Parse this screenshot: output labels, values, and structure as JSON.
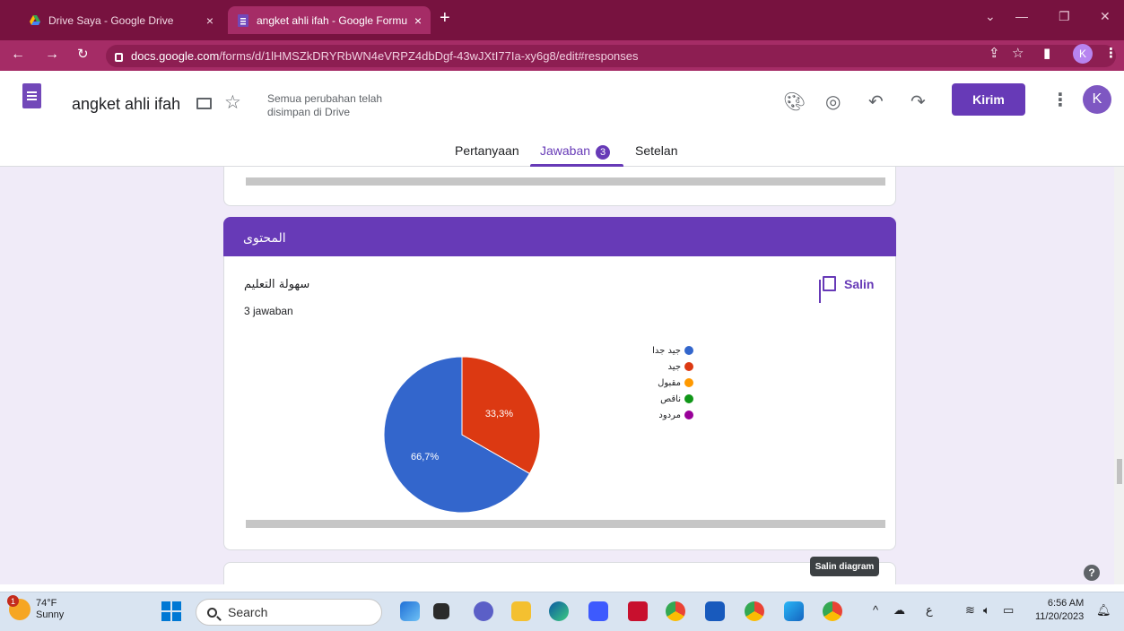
{
  "browser": {
    "tabs": [
      {
        "title": "Drive Saya - Google Drive",
        "icon": "google-drive-icon",
        "active": false
      },
      {
        "title": "angket ahli ifah - Google Formul",
        "icon": "google-forms-icon",
        "active": true
      }
    ],
    "url_host": "docs.google.com",
    "url_path": "/forms/d/1lHMSZkDRYRbWN4eVRPZ4dbDgf-43wJXtI77Ia-xy6g8/edit#responses",
    "profile_initial": "K"
  },
  "form": {
    "title": "angket ahli ifah",
    "save_status": "Semua perubahan telah disimpan di Drive",
    "send_label": "Kirim",
    "avatar_initial": "K",
    "tabs": [
      {
        "label": "Pertanyaan"
      },
      {
        "label": "Jawaban",
        "badge": "3"
      },
      {
        "label": "Setelan"
      }
    ]
  },
  "section": {
    "title": "المحتوى",
    "question": "سهولة التعليم",
    "response_count": "3 jawaban",
    "copy_label": "Salin",
    "tooltip": "Salin diagram"
  },
  "chart_data": {
    "type": "pie",
    "slices": [
      {
        "label": "جيد جدا",
        "value": 66.7,
        "display": "66,7%",
        "color": "#3366cc"
      },
      {
        "label": "جيد",
        "value": 33.3,
        "display": "33,3%",
        "color": "#dc3912"
      },
      {
        "label": "مقبول",
        "value": 0,
        "display": "",
        "color": "#ff9900"
      },
      {
        "label": "ناقص",
        "value": 0,
        "display": "",
        "color": "#109618"
      },
      {
        "label": "مردود",
        "value": 0,
        "display": "",
        "color": "#990099"
      }
    ],
    "legend_position": "right"
  },
  "taskbar": {
    "weather_temp": "74°F",
    "weather_desc": "Sunny",
    "notification_count": "1",
    "search_placeholder": "Search",
    "ime_char": "ع",
    "time": "6:56 AM",
    "date": "11/20/2023"
  }
}
